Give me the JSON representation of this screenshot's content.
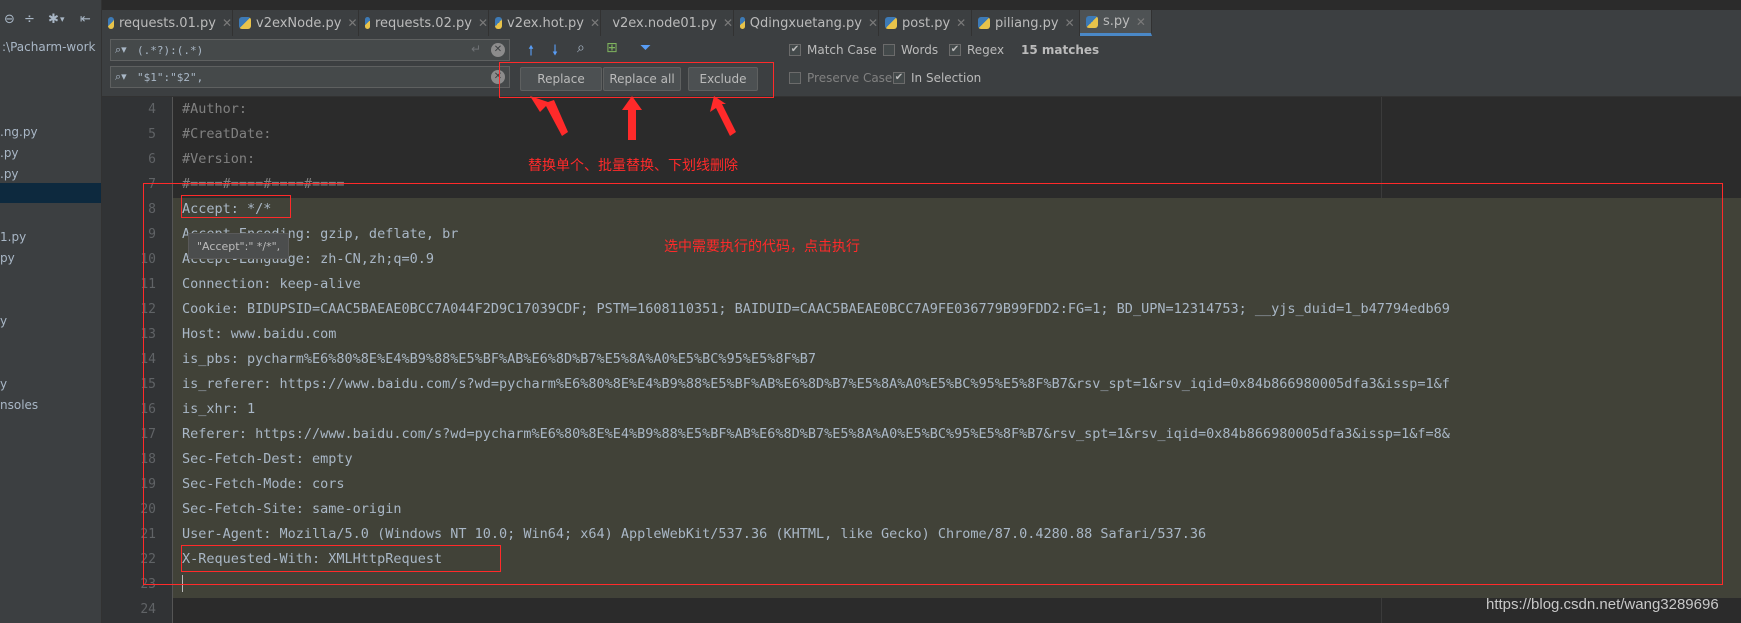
{
  "project": {
    "root_label": ":\\Pacharm-work",
    "items": [
      ".ng.py",
      ".py",
      ".py",
      "1.py",
      "py",
      "y",
      "y",
      "nsoles"
    ]
  },
  "tabs": [
    {
      "label": "requests.01.py"
    },
    {
      "label": "v2exNode.py"
    },
    {
      "label": "requests.02.py"
    },
    {
      "label": "v2ex.hot.py"
    },
    {
      "label": "v2ex.node01.py"
    },
    {
      "label": "Qdingxuetang.py"
    },
    {
      "label": "post.py"
    },
    {
      "label": "piliang.py"
    },
    {
      "label": "s.py"
    }
  ],
  "find": {
    "search_value": "(.*?):(.*)",
    "replace_value": "\"$1\":\"$2\",",
    "replace_label": "Replace",
    "replace_all_label": "Replace all",
    "exclude_label": "Exclude",
    "match_case_label": "Match Case",
    "words_label": "Words",
    "regex_label": "Regex",
    "matches_label": "15 matches",
    "preserve_case_label": "Preserve Case",
    "in_selection_label": "In Selection"
  },
  "editor": {
    "lines": [
      {
        "n": "4",
        "text": "#Author:"
      },
      {
        "n": "5",
        "text": "#CreatDate:"
      },
      {
        "n": "6",
        "text": "#Version:"
      },
      {
        "n": "7",
        "text": "#====#====#====#===="
      },
      {
        "n": "8",
        "text": "Accept: */*"
      },
      {
        "n": "9",
        "text": "Accept-Encoding: gzip, deflate, br"
      },
      {
        "n": "10",
        "text": "Accept-Language: zh-CN,zh;q=0.9"
      },
      {
        "n": "11",
        "text": "Connection: keep-alive"
      },
      {
        "n": "12",
        "text": "Cookie: BIDUPSID=CAAC5BAEAE0BCC7A044F2D9C17039CDF; PSTM=1608110351; BAIDUID=CAAC5BAEAE0BCC7A9FE036779B99FDD2:FG=1; BD_UPN=12314753; __yjs_duid=1_b47794edb69"
      },
      {
        "n": "13",
        "text": "Host: www.baidu.com"
      },
      {
        "n": "14",
        "text": "is_pbs: pycharm%E6%80%8E%E4%B9%88%E5%BF%AB%E6%8D%B7%E5%8A%A0%E5%BC%95%E5%8F%B7"
      },
      {
        "n": "15",
        "text": "is_referer: https://www.baidu.com/s?wd=pycharm%E6%80%8E%E4%B9%88%E5%BF%AB%E6%8D%B7%E5%8A%A0%E5%BC%95%E5%8F%B7&rsv_spt=1&rsv_iqid=0x84b866980005dfa3&issp=1&f"
      },
      {
        "n": "16",
        "text": "is_xhr: 1"
      },
      {
        "n": "17",
        "text": "Referer: https://www.baidu.com/s?wd=pycharm%E6%80%8E%E4%B9%88%E5%BF%AB%E6%8D%B7%E5%8A%A0%E5%BC%95%E5%8F%B7&rsv_spt=1&rsv_iqid=0x84b866980005dfa3&issp=1&f=8&"
      },
      {
        "n": "18",
        "text": "Sec-Fetch-Dest: empty"
      },
      {
        "n": "19",
        "text": "Sec-Fetch-Mode: cors"
      },
      {
        "n": "20",
        "text": "Sec-Fetch-Site: same-origin"
      },
      {
        "n": "21",
        "text": "User-Agent: Mozilla/5.0 (Windows NT 10.0; Win64; x64) AppleWebKit/537.36 (KHTML, like Gecko) Chrome/87.0.4280.88 Safari/537.36"
      },
      {
        "n": "22",
        "text": "X-Requested-With: XMLHttpRequest"
      },
      {
        "n": "23",
        "text": ""
      },
      {
        "n": "24",
        "text": ""
      }
    ],
    "tooltip": "\"Accept\":\" */*\","
  },
  "annotations": {
    "buttons_note": "替换单个、批量替换、下划线删除",
    "select_note": "选中需要执行的代码，点击执行"
  },
  "watermark": "https://blog.csdn.net/wang3289696",
  "colors": {
    "accent": "#4a88c7",
    "annotation_red": "#ff2a2a",
    "background": "#2b2b2b"
  }
}
